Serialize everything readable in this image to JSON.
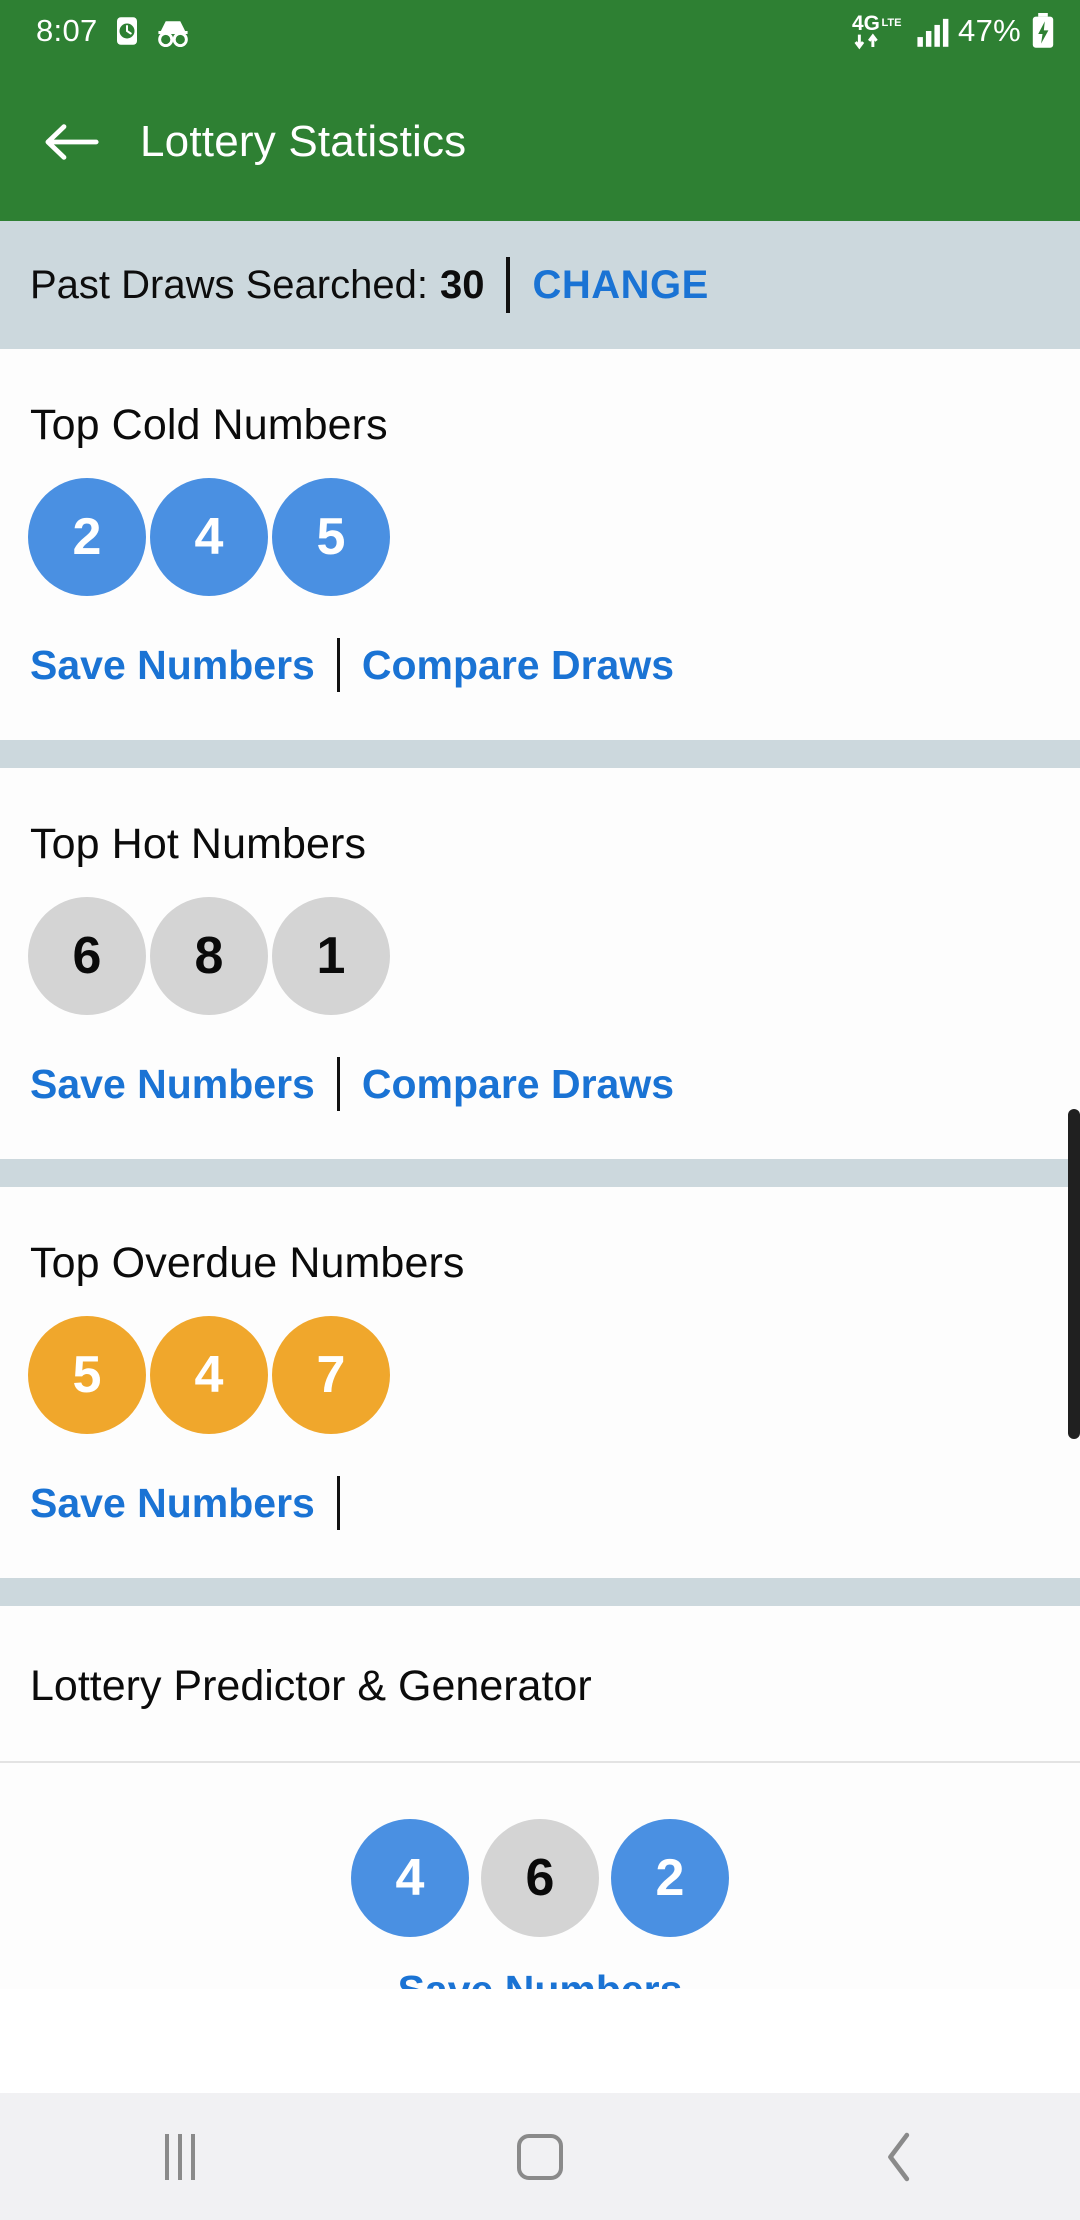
{
  "status_bar": {
    "time": "8:07",
    "icons_left": [
      "alarm-icon",
      "incognito-glasses-icon"
    ],
    "network_label": "4G",
    "network_sub": "LTE",
    "icons_right": [
      "signal-bars-icon",
      "battery-charging-icon"
    ],
    "battery_percent": "47%",
    "background_color": "#2e8033"
  },
  "app_bar": {
    "back_icon": "back-arrow-icon",
    "title": "Lottery Statistics",
    "background_color": "#2e8033",
    "text_color": "#ffffff"
  },
  "info_bar": {
    "label": "Past Draws Searched:",
    "value": "30",
    "change_label": "CHANGE",
    "background_color": "#ccd8dd",
    "link_color": "#1a73d4"
  },
  "sections": [
    {
      "title": "Top Cold Numbers",
      "ball_style": "blue",
      "ball_color": "#4a90e2",
      "numbers": [
        "2",
        "4",
        "5"
      ],
      "actions": [
        "Save Numbers",
        "Compare Draws"
      ]
    },
    {
      "title": "Top Hot Numbers",
      "ball_style": "grey",
      "ball_color": "#d4d4d4",
      "numbers": [
        "6",
        "8",
        "1"
      ],
      "actions": [
        "Save Numbers",
        "Compare Draws"
      ]
    },
    {
      "title": "Top Overdue Numbers",
      "ball_style": "orange",
      "ball_color": "#f0a72c",
      "numbers": [
        "5",
        "4",
        "7"
      ],
      "actions": [
        "Save Numbers"
      ]
    }
  ],
  "predictor": {
    "title": "Lottery Predictor & Generator",
    "numbers": [
      {
        "value": "4",
        "style": "blue"
      },
      {
        "value": "6",
        "style": "grey"
      },
      {
        "value": "2",
        "style": "blue"
      }
    ],
    "cut_off_action": "Save Numbers"
  },
  "nav_bar": {
    "recents_icon": "recents-icon",
    "home_icon": "home-icon",
    "back_icon": "back-chevron-icon",
    "background_color": "#f1f1f3"
  }
}
